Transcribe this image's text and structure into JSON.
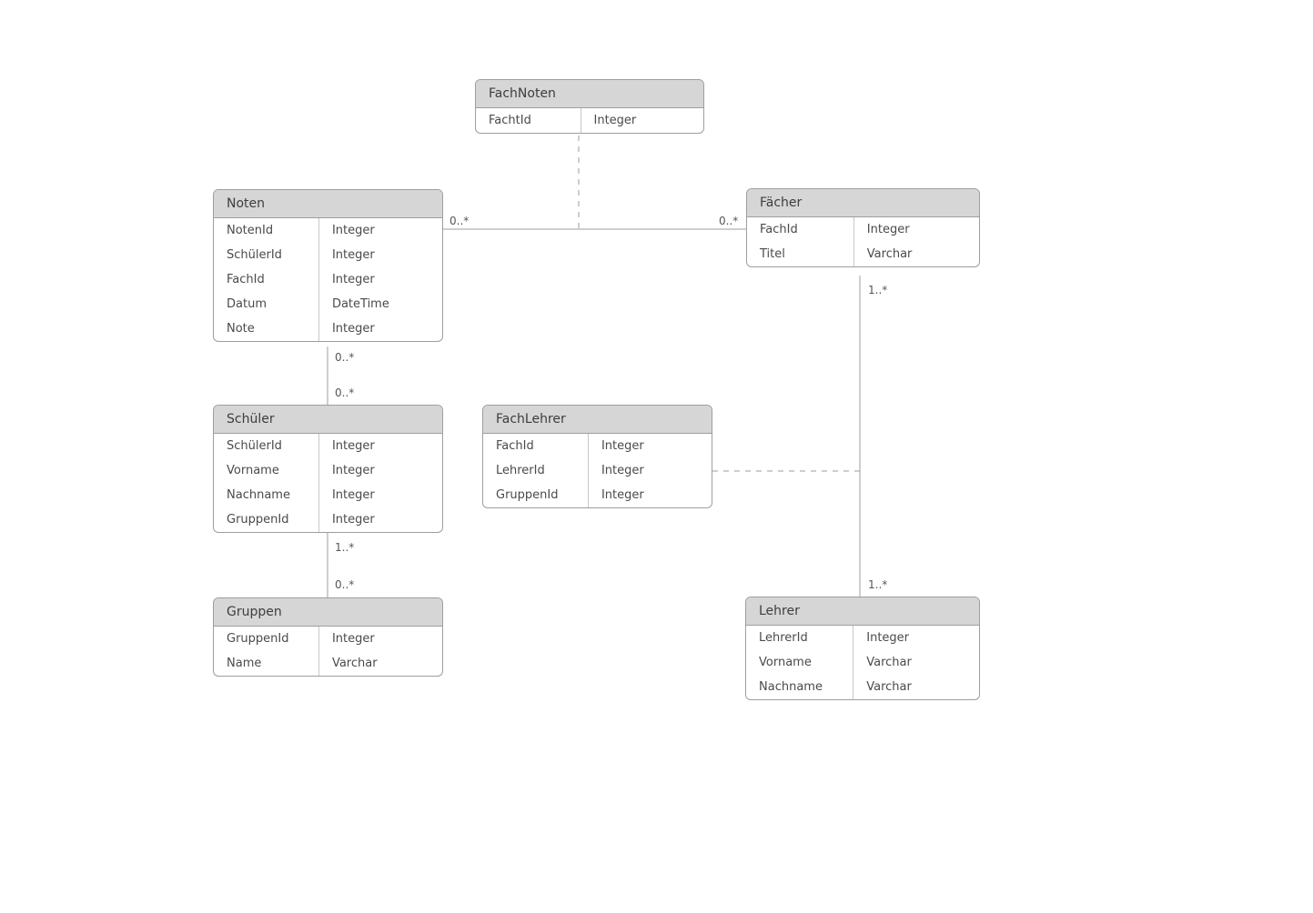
{
  "entities": {
    "fachnoten": {
      "title": "FachNoten",
      "rows": [
        {
          "name": "FachtId",
          "type": "Integer"
        }
      ]
    },
    "noten": {
      "title": "Noten",
      "rows": [
        {
          "name": "NotenId",
          "type": "Integer"
        },
        {
          "name": "SchülerId",
          "type": "Integer"
        },
        {
          "name": "FachId",
          "type": "Integer"
        },
        {
          "name": "Datum",
          "type": "DateTime"
        },
        {
          "name": "Note",
          "type": "Integer"
        }
      ]
    },
    "faecher": {
      "title": "Fächer",
      "rows": [
        {
          "name": "FachId",
          "type": "Integer"
        },
        {
          "name": "Titel",
          "type": "Varchar"
        }
      ]
    },
    "schueler": {
      "title": "Schüler",
      "rows": [
        {
          "name": "SchülerId",
          "type": "Integer"
        },
        {
          "name": "Vorname",
          "type": "Integer"
        },
        {
          "name": "Nachname",
          "type": "Integer"
        },
        {
          "name": "GruppenId",
          "type": "Integer"
        }
      ]
    },
    "fachlehrer": {
      "title": "FachLehrer",
      "rows": [
        {
          "name": "FachId",
          "type": "Integer"
        },
        {
          "name": "LehrerId",
          "type": "Integer"
        },
        {
          "name": "GruppenId",
          "type": "Integer"
        }
      ]
    },
    "gruppen": {
      "title": "Gruppen",
      "rows": [
        {
          "name": "GruppenId",
          "type": "Integer"
        },
        {
          "name": "Name",
          "type": "Varchar"
        }
      ]
    },
    "lehrer": {
      "title": "Lehrer",
      "rows": [
        {
          "name": "LehrerId",
          "type": "Integer"
        },
        {
          "name": "Vorname",
          "type": "Varchar"
        },
        {
          "name": "Nachname",
          "type": "Varchar"
        }
      ]
    }
  },
  "multiplicities": {
    "noten_faecher_left": "0..*",
    "noten_faecher_right": "0..*",
    "noten_schueler_top": "0..*",
    "noten_schueler_bottom": "0..*",
    "schueler_gruppen_top": "1..*",
    "schueler_gruppen_bottom": "0..*",
    "faecher_lehrer_top": "1..*",
    "faecher_lehrer_bottom": "1..*"
  }
}
